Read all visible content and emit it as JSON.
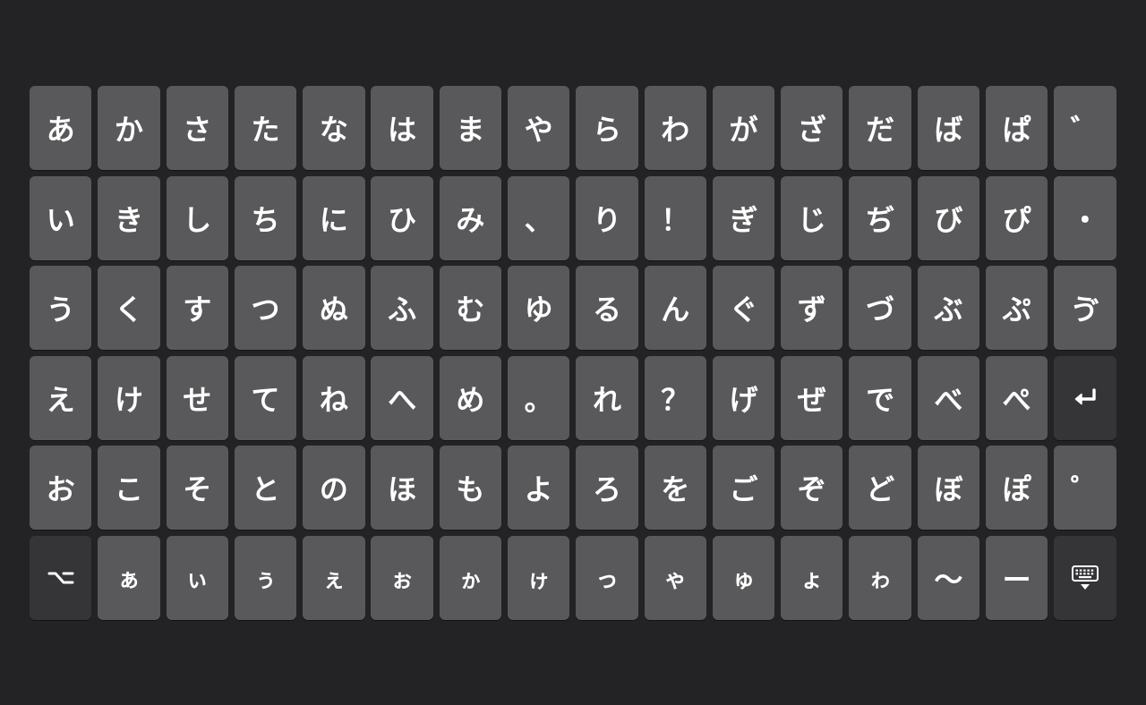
{
  "keyboard": {
    "rows": [
      [
        "あ",
        "か",
        "さ",
        "た",
        "な",
        "は",
        "ま",
        "や",
        "ら",
        "わ",
        "が",
        "ざ",
        "だ",
        "ば",
        "ぱ",
        "゛"
      ],
      [
        "い",
        "き",
        "し",
        "ち",
        "に",
        "ひ",
        "み",
        "、",
        "り",
        "！",
        "ぎ",
        "じ",
        "ぢ",
        "び",
        "ぴ",
        "・"
      ],
      [
        "う",
        "く",
        "す",
        "つ",
        "ぬ",
        "ふ",
        "む",
        "ゆ",
        "る",
        "ん",
        "ぐ",
        "ず",
        "づ",
        "ぶ",
        "ぷ",
        "ゔ"
      ],
      [
        "え",
        "け",
        "せ",
        "て",
        "ね",
        "へ",
        "め",
        "。",
        "れ",
        "？",
        "げ",
        "ぜ",
        "で",
        "べ",
        "ぺ"
      ],
      [
        "お",
        "こ",
        "そ",
        "と",
        "の",
        "ほ",
        "も",
        "よ",
        "ろ",
        "を",
        "ご",
        "ぞ",
        "ど",
        "ぼ",
        "ぽ",
        "゜"
      ],
      [
        "ぁ",
        "ぃ",
        "ぅ",
        "ぇ",
        "ぉ",
        "ゕ",
        "ゖ",
        "っ",
        "ゃ",
        "ゅ",
        "ょ",
        "ゎ",
        "〜",
        "ー"
      ]
    ],
    "special_keys": {
      "return": "return-icon",
      "option": "option-key-icon",
      "hide_keyboard": "keyboard-hide-icon"
    },
    "colors": {
      "background": "#232325",
      "key": "#59595b",
      "special_key": "#353537",
      "label": "#ffffff"
    }
  }
}
